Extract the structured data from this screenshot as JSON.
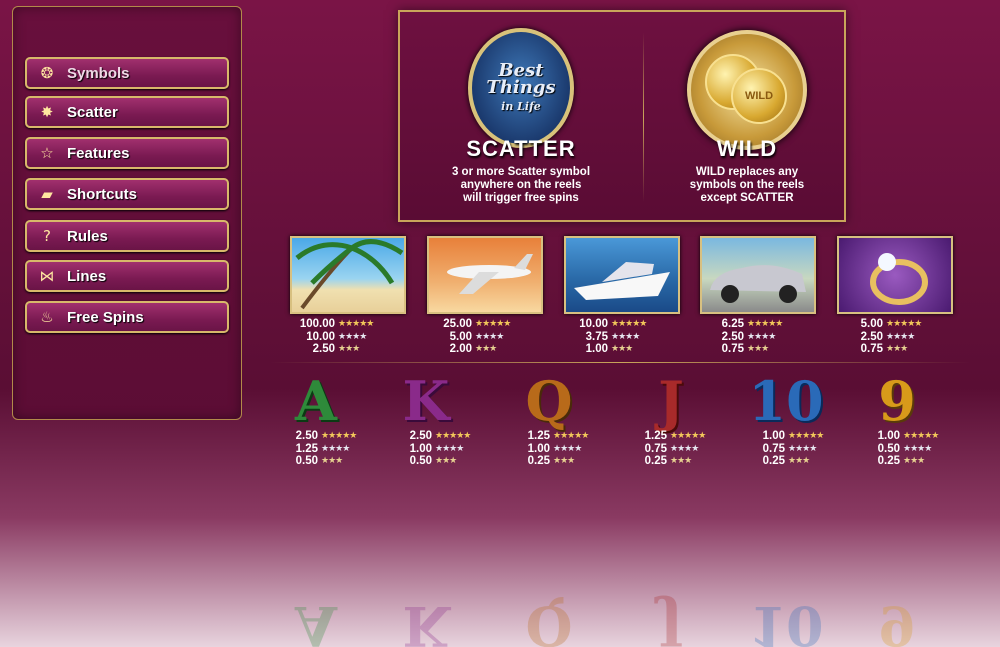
{
  "menu": {
    "items": [
      {
        "label": "Symbols",
        "icon": "symbols-icon",
        "glyph": "❂"
      },
      {
        "label": "Scatter",
        "icon": "burst-icon",
        "glyph": "✸"
      },
      {
        "label": "Features",
        "icon": "star-icon",
        "glyph": "☆"
      },
      {
        "label": "Shortcuts",
        "icon": "keyboard-icon",
        "glyph": "▰"
      },
      {
        "label": "Rules",
        "icon": "question-icon",
        "glyph": "?"
      },
      {
        "label": "Lines",
        "icon": "lines-icon",
        "glyph": "⋈"
      },
      {
        "label": "Free Spins",
        "icon": "free-spins-icon",
        "glyph": "♨"
      }
    ]
  },
  "scatter": {
    "title": "SCATTER",
    "desc": [
      "3 or more Scatter symbol",
      "anywhere on the reels",
      "will trigger free spins"
    ],
    "emblem_text": [
      "Best",
      "Things",
      "in Life"
    ]
  },
  "wild": {
    "title": "WILD",
    "desc": [
      "WILD replaces any",
      "symbols on the reels",
      "except SCATTER"
    ],
    "coin_text": "WILD"
  },
  "premium_symbols": [
    {
      "name": "beach",
      "pays": [
        "100.00",
        "10.00",
        "2.50"
      ]
    },
    {
      "name": "private-jet",
      "pays": [
        "25.00",
        "5.00",
        "2.00"
      ]
    },
    {
      "name": "yacht",
      "pays": [
        "10.00",
        "3.75",
        "1.00"
      ]
    },
    {
      "name": "sports-car",
      "pays": [
        "6.25",
        "2.50",
        "0.75"
      ]
    },
    {
      "name": "diamond-ring",
      "pays": [
        "5.00",
        "2.50",
        "0.75"
      ]
    }
  ],
  "card_symbols": [
    {
      "glyph": "A",
      "color": "#2e8a3a",
      "pays": [
        "2.50",
        "1.25",
        "0.50"
      ]
    },
    {
      "glyph": "K",
      "color": "#8a2a8a",
      "pays": [
        "2.50",
        "1.00",
        "0.50"
      ]
    },
    {
      "glyph": "Q",
      "color": "#b86a1a",
      "pays": [
        "1.25",
        "1.00",
        "0.25"
      ]
    },
    {
      "glyph": "J",
      "color": "#a82a2a",
      "pays": [
        "1.25",
        "0.75",
        "0.25"
      ]
    },
    {
      "glyph": "10",
      "color": "#2a6ab8",
      "pays": [
        "1.00",
        "0.75",
        "0.25"
      ]
    },
    {
      "glyph": "9",
      "color": "#d89a1a",
      "pays": [
        "1.00",
        "0.50",
        "0.25"
      ]
    }
  ],
  "stars": {
    "five": "★★★★★",
    "four": "★★★★",
    "three": "★★★"
  },
  "colors": {
    "background": "#64103a",
    "gold": "#d8b86a",
    "text": "#ffffff"
  }
}
